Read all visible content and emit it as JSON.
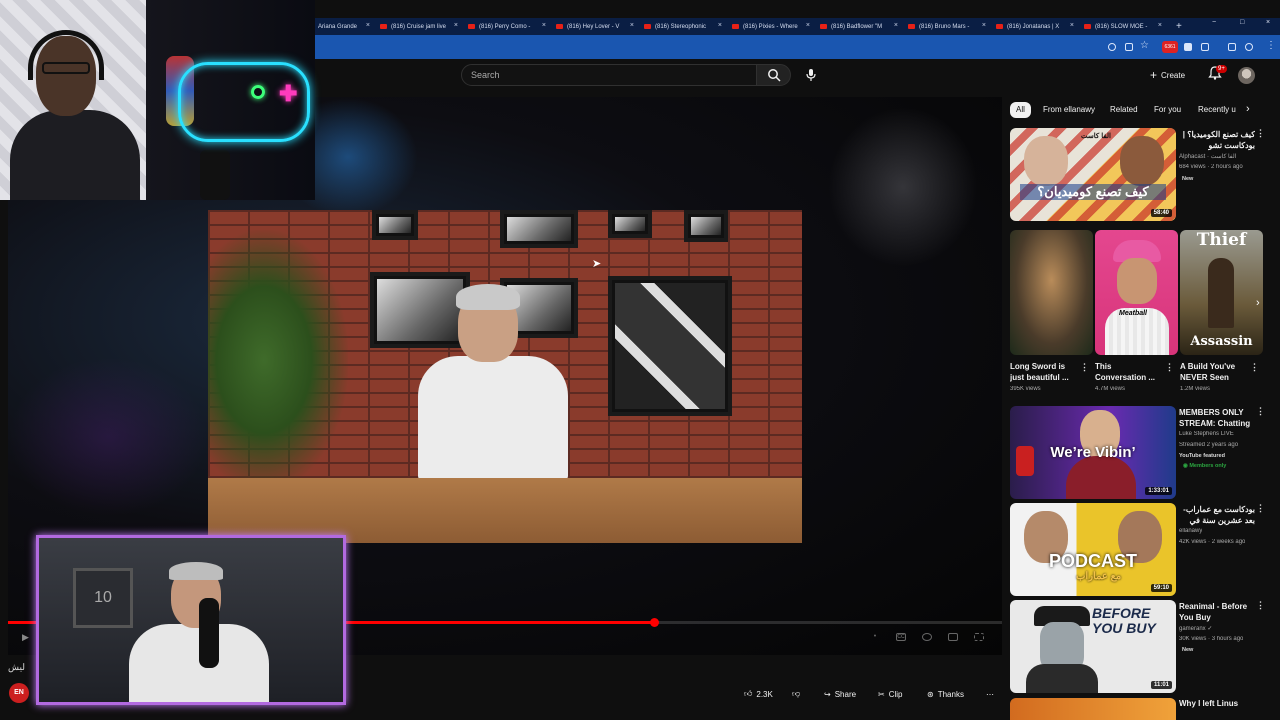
{
  "browser": {
    "tabs": [
      {
        "label": "Ariana Grande",
        "has_favicon": false
      },
      {
        "label": "(816) Cruise jam live",
        "has_favicon": true
      },
      {
        "label": "(816) Perry Como -",
        "has_favicon": true
      },
      {
        "label": "(816) Hey Lover - V",
        "has_favicon": true
      },
      {
        "label": "(816) Stereophonic",
        "has_favicon": true
      },
      {
        "label": "(816) Pixies - Where",
        "has_favicon": true
      },
      {
        "label": "(816) Badflower \"M",
        "has_favicon": true
      },
      {
        "label": "(816) Bruno Mars -",
        "has_favicon": true
      },
      {
        "label": "(816) Jonatanas | X",
        "has_favicon": true
      },
      {
        "label": "(816) SLOW MOE -",
        "has_favicon": true
      }
    ],
    "close_glyph": "×",
    "new_tab_glyph": "+",
    "window_buttons": [
      "−",
      "□",
      "×"
    ],
    "extension_badge": "6361",
    "accent_color": "#1a56b0"
  },
  "header": {
    "search_placeholder": "Search",
    "create_label": "Create",
    "notifications_count": "9+"
  },
  "player": {
    "progress": 0.65
  },
  "chips": [
    {
      "label": "All",
      "active": true
    },
    {
      "label": "From ellanawy",
      "active": false
    },
    {
      "label": "Related",
      "active": false
    },
    {
      "label": "For you",
      "active": false
    },
    {
      "label": "Recently u",
      "active": false
    }
  ],
  "recommendations": [
    {
      "title": "كيف تصنع الكوميديا؟ | بودكاست تشو الكوميديا مع",
      "channel": "Alphacast",
      "channel_extra": "آلفا كاست",
      "views": "684 views",
      "age": "2 hours ago",
      "badge": "New",
      "duration": "58:40",
      "thumb_text": "كيف تصنع كوميديان؟",
      "thumb_caption": "الفا كاست"
    },
    {
      "title": "MEMBERS ONLY STREAM: Chatting ...",
      "channel": "Luke Stephens LIVE",
      "views": "Streamed 2 years ago",
      "age": "",
      "badge": "YouTube featured",
      "members": "Members only",
      "duration": "1:33:01",
      "thumb_text": "We’re Vibin’"
    },
    {
      "title": "بودكاست مع عماراب- بعد عشرين سنة في مجال الترف",
      "channel": "ellanawy",
      "views": "42K views",
      "age": "2 weeks ago",
      "badge": "",
      "duration": "59:10",
      "thumb_text": "PODCAST",
      "thumb_caption": "مع عماراب"
    },
    {
      "title": "Reanimal - Before You Buy",
      "channel": "gameranx",
      "views": "30K views",
      "age": "3 hours ago",
      "badge": "New",
      "duration": "11:01",
      "thumb_text": "BEFORE YOU BUY"
    },
    {
      "title": "Why I left Linus",
      "channel": "",
      "views": "",
      "age": "",
      "badge": "",
      "duration": ""
    }
  ],
  "shorts": [
    {
      "title": "Long Sword is just beautiful ...",
      "views": "395K views"
    },
    {
      "title": "This Conversation ...",
      "views": "4.7M views",
      "thumb_text": "Meatball"
    },
    {
      "title": "A Build You've NEVER Seen",
      "views": "1.2M views",
      "thumb_top": "Thief",
      "thumb_bottom": "Assassin"
    }
  ],
  "actions": {
    "likes": "2.3K",
    "share": "Share",
    "clip": "Clip",
    "thanks": "Thanks",
    "more": "⋯"
  },
  "overlay": {
    "label": "ليش",
    "logo_text": "EN",
    "jersey_number": "10"
  },
  "icons": {
    "search": "search-icon",
    "mic": "mic-icon",
    "bell": "bell-icon",
    "like": "thumbs-up-icon",
    "dislike": "thumbs-down-icon",
    "share": "share-icon",
    "clip": "scissors-icon",
    "thanks": "thanks-icon"
  }
}
